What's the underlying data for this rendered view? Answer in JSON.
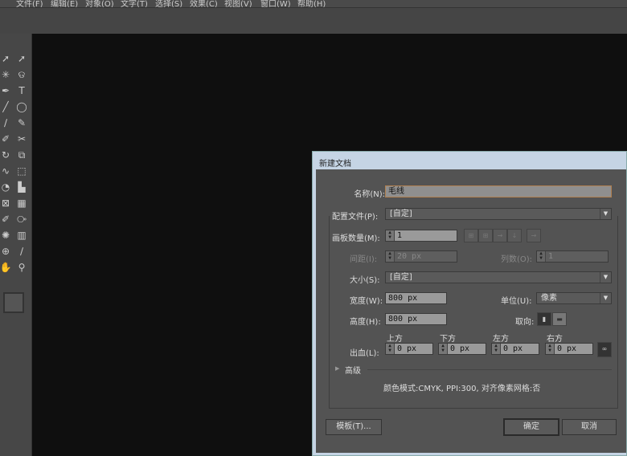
{
  "menu": [
    "文件(F)",
    "编辑(E)",
    "对象(O)",
    "文字(T)",
    "选择(S)",
    "效果(C)",
    "视图(V)",
    "窗口(W)",
    "帮助(H)"
  ],
  "tools": [
    "selection-tool",
    "direct-selection-tool",
    "magic-wand-tool",
    "lasso-tool",
    "pen-tool",
    "type-tool",
    "line-tool",
    "ellipse-tool",
    "paintbrush-tool",
    "pencil-tool",
    "blob-brush-tool",
    "scissors-tool",
    "rotate-tool",
    "scale-tool",
    "warp-tool",
    "free-transform-tool",
    "shape-builder-tool",
    "perspective-grid-tool",
    "mesh-tool",
    "gradient-tool",
    "eyedropper-tool",
    "blend-tool",
    "symbol-sprayer-tool",
    "column-graph-tool",
    "artboard-tool",
    "slice-tool",
    "hand-tool",
    "zoom-tool"
  ],
  "dialog": {
    "title": "新建文档",
    "name_label": "名称(N):",
    "name_value": "毛线",
    "profile_label": "配置文件(P):",
    "profile_value": "[自定]",
    "artboards_label": "画板数量(M):",
    "artboards_value": "1",
    "spacing_label": "间距(I):",
    "spacing_value": "20 px",
    "columns_label": "列数(O):",
    "columns_value": "1",
    "size_label": "大小(S):",
    "size_value": "[自定]",
    "width_label": "宽度(W):",
    "width_value": "800 px",
    "units_label": "单位(U):",
    "units_value": "像素",
    "height_label": "高度(H):",
    "height_value": "800 px",
    "orientation_label": "取向:",
    "bleed_label": "出血(L):",
    "bleed": [
      {
        "label": "上方",
        "value": "0 px"
      },
      {
        "label": "下方",
        "value": "0 px"
      },
      {
        "label": "左方",
        "value": "0 px"
      },
      {
        "label": "右方",
        "value": "0 px"
      }
    ],
    "advanced_label": "高级",
    "info": "颜色模式:CMYK, PPI:300, 对齐像素网格:否",
    "templates_button": "模板(T)...",
    "ok_button": "确定",
    "cancel_button": "取消"
  }
}
